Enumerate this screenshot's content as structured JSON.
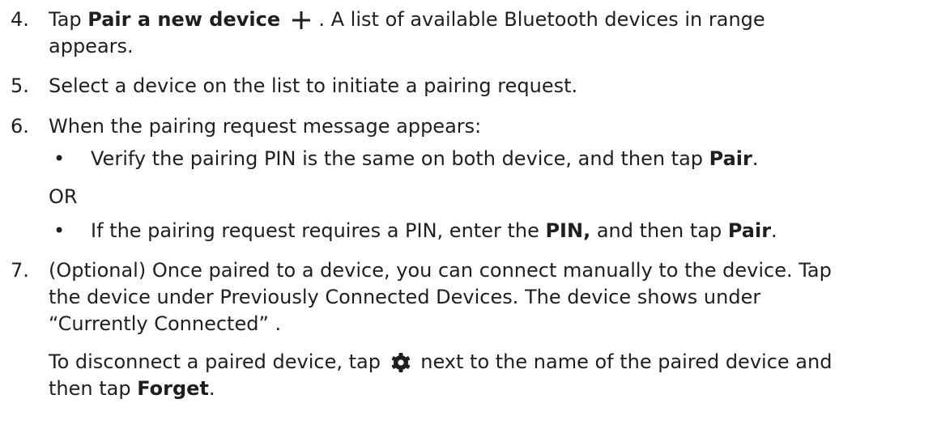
{
  "steps": [
    {
      "number": "4.",
      "pre": "Tap ",
      "bold": "Pair a new device",
      "post": " . A list of available Bluetooth devices in range",
      "line2": "appears.",
      "icon": "plus-icon"
    },
    {
      "number": "5.",
      "text": "Select a device on the list to initiate a pairing request."
    },
    {
      "number": "6.",
      "text": "When the pairing request message appears:",
      "bullets": [
        {
          "pre": "Verify the pairing PIN is the same on both device, and then tap ",
          "bold": "Pair",
          "post": "."
        },
        {
          "pre": "If the pairing request requires a PIN, enter the ",
          "bold": "PIN,",
          "mid": " and then tap ",
          "bold2": "Pair",
          "post": "."
        }
      ],
      "or": "OR"
    },
    {
      "number": "7.",
      "line1": "(Optional) Once paired to a device, you can connect manually to the device. Tap",
      "line2": "the device under Previously Connected Devices. The device shows under",
      "line3": "“Currently Connected” .",
      "note_pre": "To disconnect a paired device, tap ",
      "note_post": " next to the name of the paired device and",
      "note_line2_pre": "then tap ",
      "note_bold": "Forget",
      "note_end": ".",
      "icon": "gear-icon"
    }
  ],
  "bullet_char": "•"
}
